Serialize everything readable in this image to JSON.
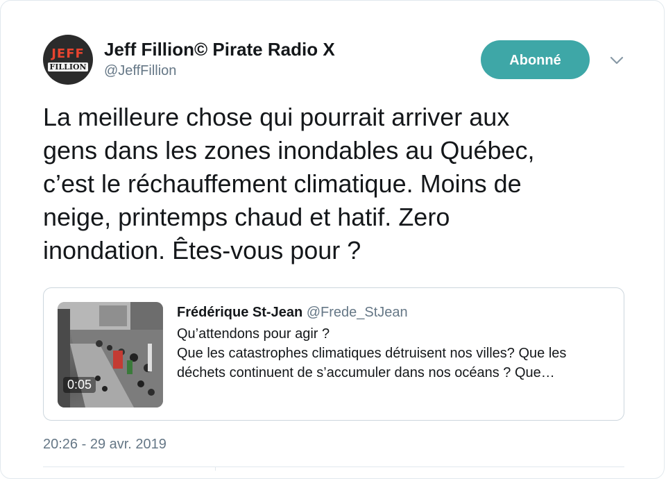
{
  "author": {
    "avatar_line1": "JEFF",
    "avatar_line2": "FILLION",
    "name": "Jeff Fillion© Pirate Radio X",
    "handle": "@JeffFillion"
  },
  "follow_button": {
    "label": "Abonné",
    "color": "#3ea7a7"
  },
  "menu": {
    "icon": "chevron-down-icon"
  },
  "tweet": {
    "lines": [
      "La meilleure chose qui pourrait arriver aux",
      "gens dans les zones inondables au Québec,",
      "c’est le réchauffement climatique. Moins de",
      "neige, printemps chaud et hatif. Zero",
      "inondation. Êtes-vous pour ?"
    ]
  },
  "quoted_tweet": {
    "name": "Frédérique St-Jean",
    "handle": "@Frede_StJean",
    "video_duration": "0:05",
    "lines": [
      "Qu’attendons pour agir ?",
      "Que les catastrophes climatiques détruisent nos villes? Que les",
      "déchets continuent de s’accumuler dans nos océans ? Que…"
    ]
  },
  "timestamp": "20:26 - 29 avr. 2019",
  "colors": {
    "text": "#14171a",
    "secondary": "#657786",
    "border": "#ccd6dd"
  }
}
